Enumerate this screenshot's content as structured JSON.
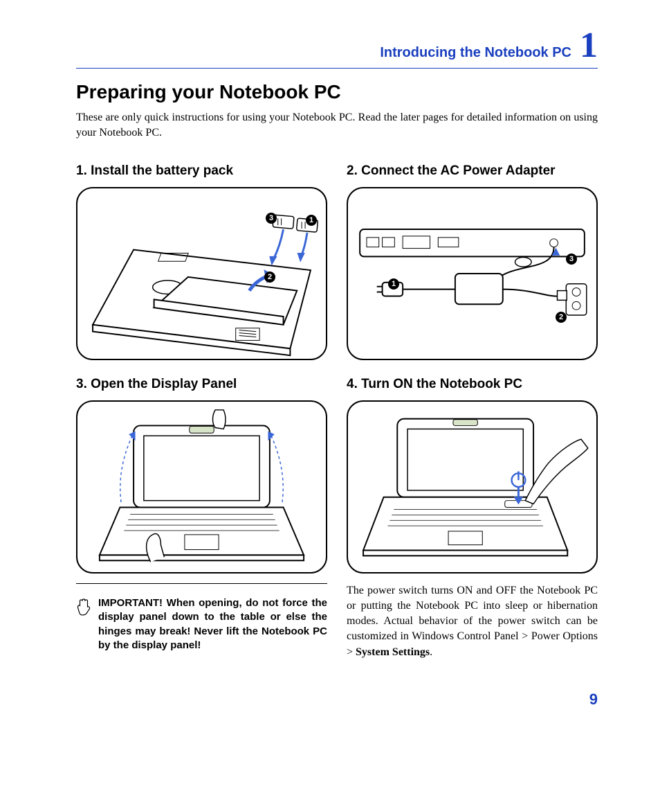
{
  "chapter": {
    "title": "Introducing the Notebook PC",
    "number": "1"
  },
  "page_title": "Preparing your Notebook PC",
  "intro": "These are only quick instructions for using your Notebook PC. Read the later pages for detailed information on using your Notebook PC.",
  "steps": {
    "s1": {
      "title": "1. Install the battery pack",
      "callouts": {
        "c1": "1",
        "c2": "2",
        "c3": "3"
      }
    },
    "s2": {
      "title": "2. Connect the AC Power Adapter",
      "callouts": {
        "c1": "1",
        "c2": "2",
        "c3": "3"
      }
    },
    "s3": {
      "title": "3. Open the Display Panel"
    },
    "s4": {
      "title": "4. Turn ON the Notebook PC"
    }
  },
  "warning": {
    "text": "IMPORTANT!  When opening, do not force the display panel down to the table or else the hinges may break! Never lift the Notebook PC by the display panel!"
  },
  "explain_prefix": "The power switch turns ON and OFF the Notebook PC or putting the Notebook PC into sleep or hibernation modes. Actual behavior of the power switch can be customized in Windows Control Panel > Power Options > ",
  "explain_bold": "System Settings",
  "explain_suffix": ".",
  "page_number": "9"
}
